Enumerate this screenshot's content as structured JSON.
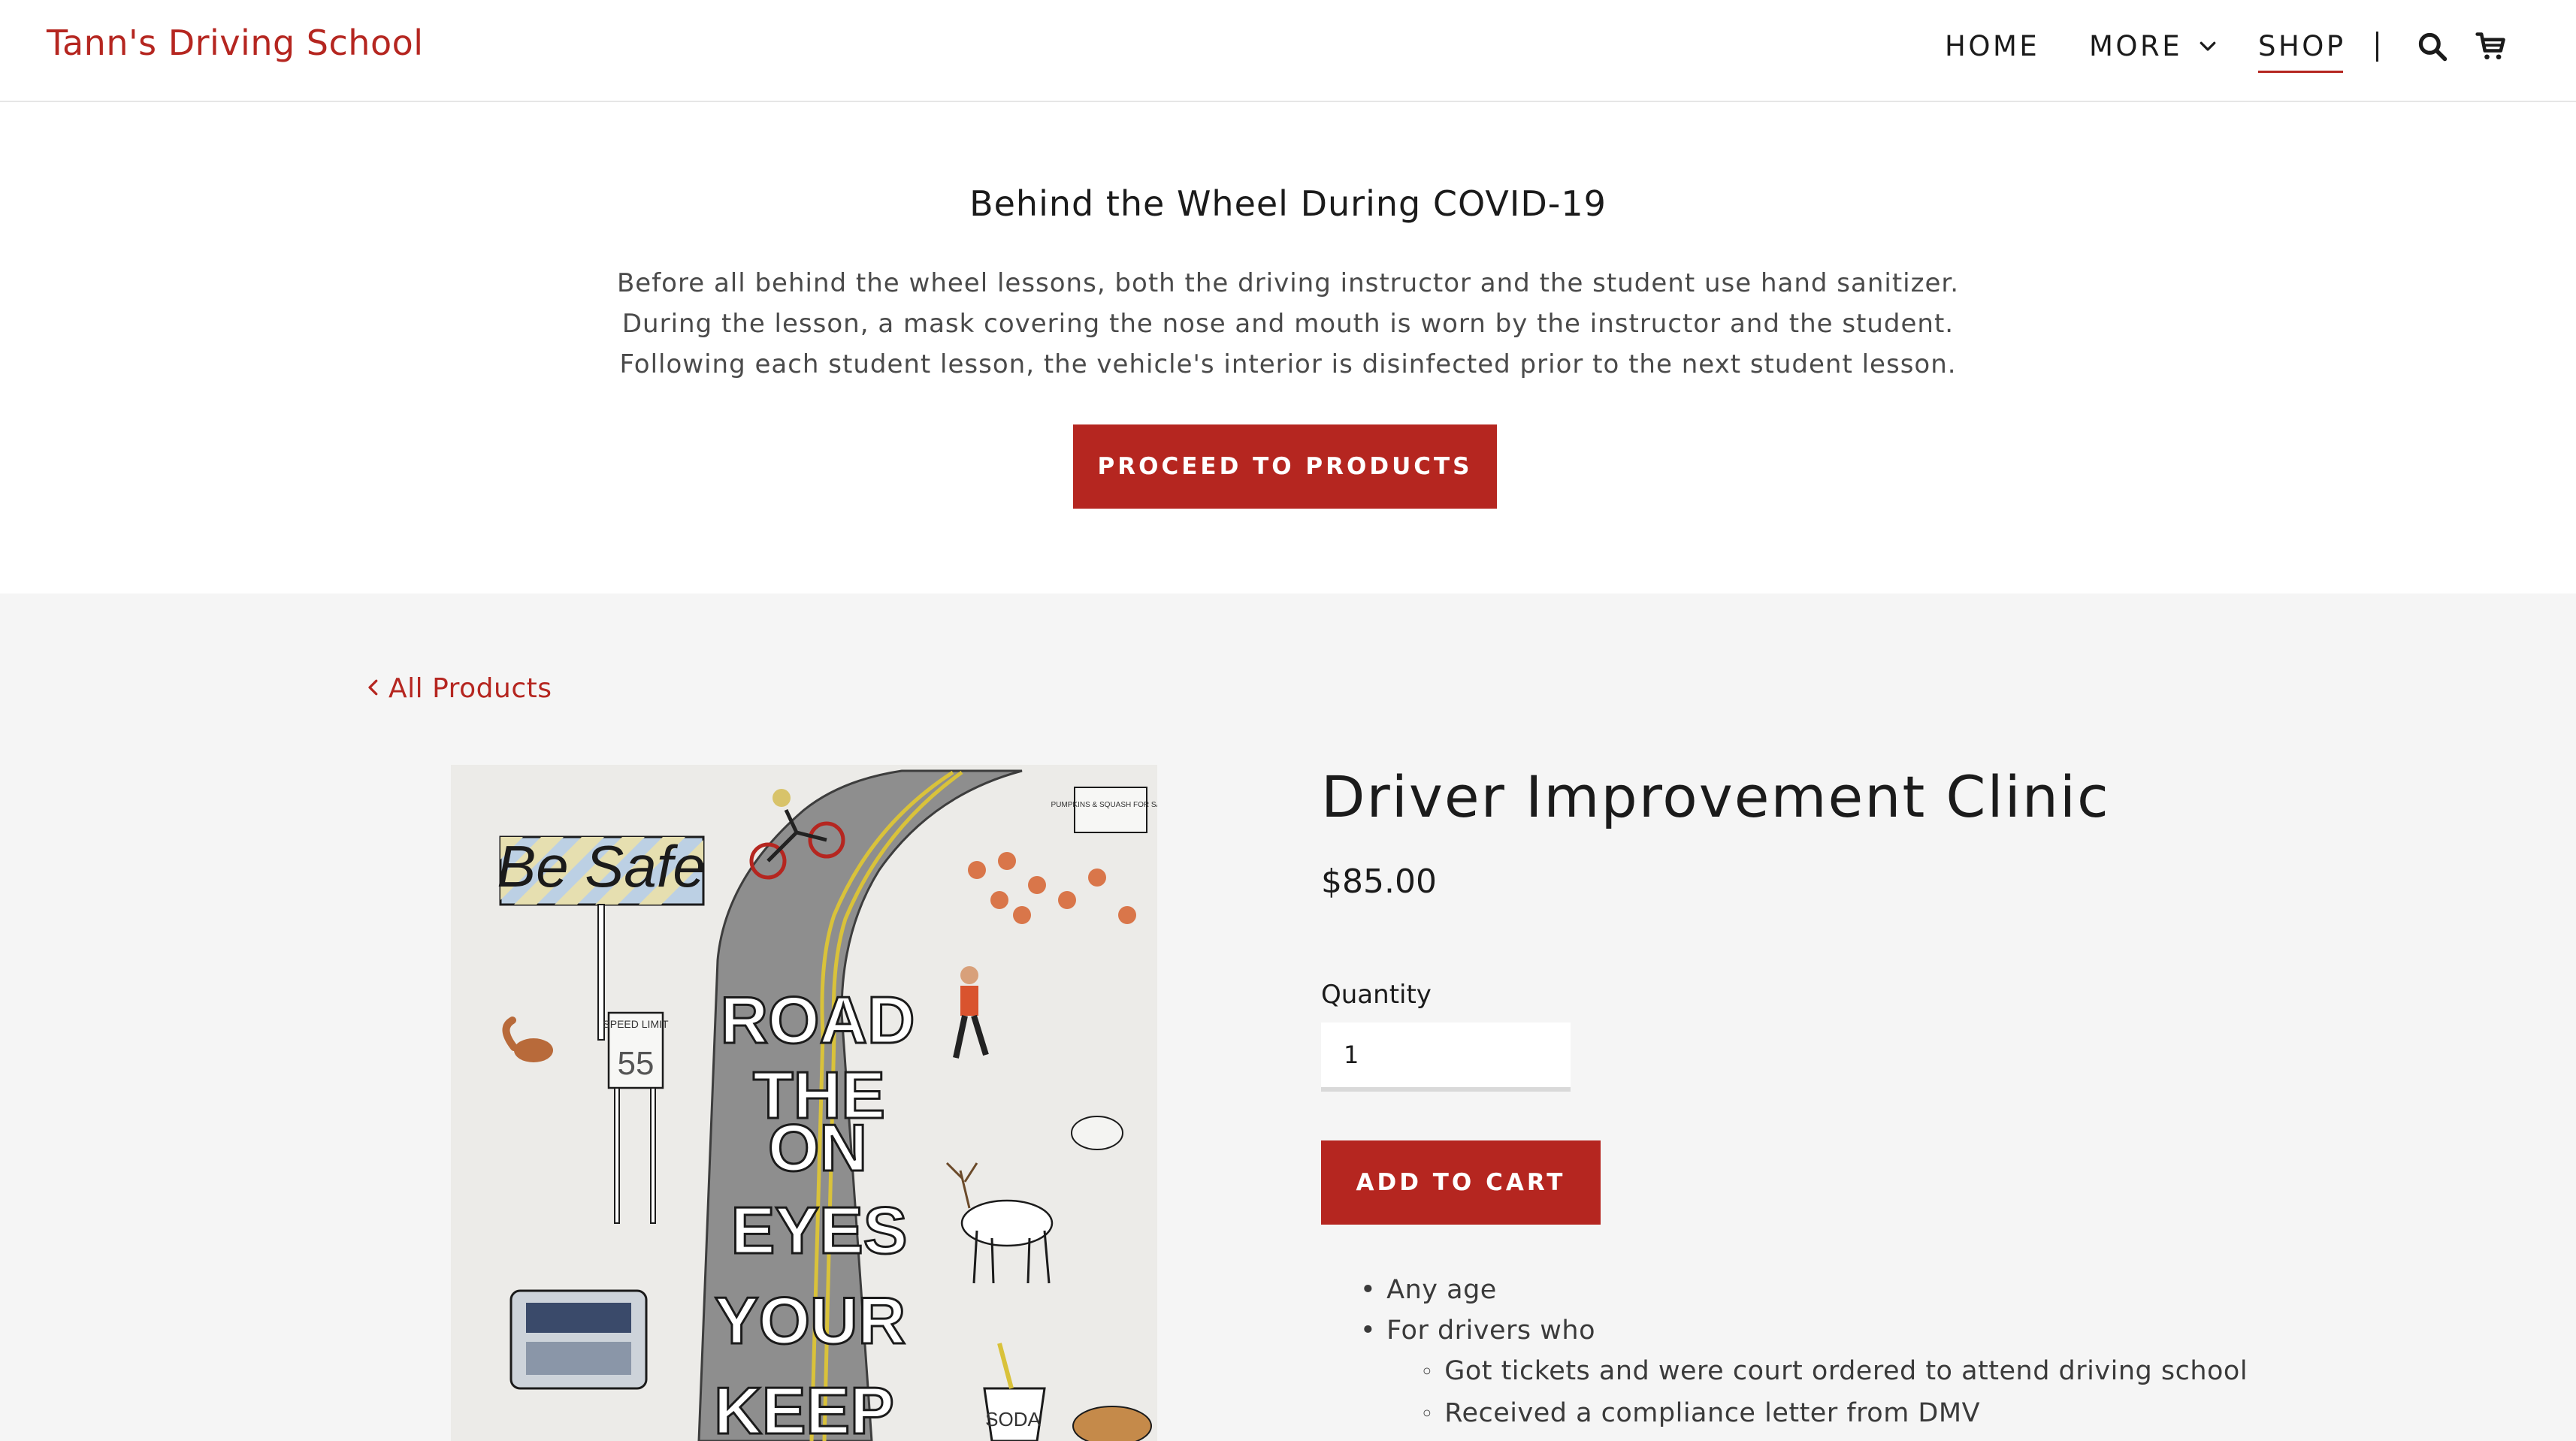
{
  "header": {
    "brand": "Tann's Driving School",
    "nav": {
      "home": "HOME",
      "more": "MORE",
      "shop": "SHOP"
    },
    "icons": [
      "search-icon",
      "cart-icon"
    ]
  },
  "covid": {
    "title": "Behind the Wheel During COVID-19",
    "lines": [
      "Before all behind the wheel lessons, both the driving instructor and the student use hand sanitizer.",
      "During the lesson, a mask covering the nose and mouth is worn by the instructor and the student.",
      "Following each student lesson, the vehicle's interior is disinfected prior to the next student lesson."
    ],
    "button": "PROCEED TO PRODUCTS"
  },
  "product": {
    "back_link": "All Products",
    "title": "Driver Improvement Clinic",
    "price": "$85.00",
    "quantity_label": "Quantity",
    "quantity_value": "1",
    "add_to_cart": "ADD TO CART",
    "details": {
      "item1": "Any age",
      "item2": "For drivers who",
      "sub1": "Got tickets and were court ordered to attend driving school",
      "sub2": "Received a compliance letter from DMV"
    },
    "image_text": {
      "sign": "Be Safe",
      "speed_label": "SPEED LIMIT",
      "speed_value": "55",
      "pumpkin_sign": "PUMPKINS & SQUASH FOR SALE",
      "road_words": [
        "ROAD",
        "THE",
        "ON",
        "EYES",
        "YOUR",
        "KEEP"
      ],
      "cup": "SODA"
    }
  },
  "colors": {
    "accent": "#b52620",
    "page_bg": "#f5f5f5",
    "header_bg": "#ffffff"
  }
}
